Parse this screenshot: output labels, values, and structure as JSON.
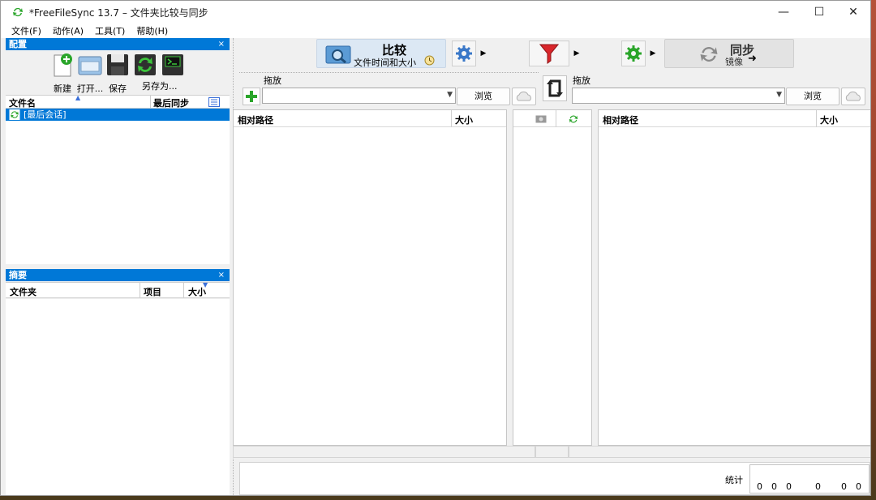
{
  "window": {
    "title": "*FreeFileSync 13.7 – 文件夹比较与同步",
    "minimize": "—",
    "maximize": "☐",
    "close": "✕"
  },
  "menu": [
    "文件(F)",
    "动作(A)",
    "工具(T)",
    "帮助(H)"
  ],
  "config_panel": {
    "title": "配置",
    "close": "×",
    "tools": [
      {
        "label": "新建",
        "icon": "new-config-icon"
      },
      {
        "label": "打开...",
        "icon": "open-config-icon"
      },
      {
        "label": "保存",
        "icon": "save-icon"
      },
      {
        "label": "另存为...",
        "icon": "save-as-icon"
      }
    ],
    "columns": {
      "name": "文件名",
      "last_sync": "最后同步"
    },
    "items": [
      {
        "name": "[最后会话]",
        "selected": true
      }
    ]
  },
  "summary_panel": {
    "title": "摘要",
    "close": "×",
    "columns": {
      "folder": "文件夹",
      "items": "项目",
      "size": "大小"
    }
  },
  "toolbar": {
    "compare": {
      "title": "比较",
      "subtitle": "文件时间和大小"
    },
    "sync": {
      "title": "同步",
      "subtitle": "镜像"
    }
  },
  "left_folder": {
    "drag_label": "拖放",
    "value": "",
    "browse": "浏览"
  },
  "right_folder": {
    "drag_label": "拖放",
    "value": "",
    "browse": "浏览"
  },
  "left_grid": {
    "col_path": "相对路径",
    "col_size": "大小"
  },
  "right_grid": {
    "col_path": "相对路径",
    "col_size": "大小"
  },
  "stats": {
    "label": "统计",
    "values": [
      "0",
      "0",
      "0",
      "0",
      "0",
      "0"
    ]
  },
  "colors": {
    "accent": "#0078d7",
    "bg": "#f0f0f0",
    "sync_green": "#2aa52a",
    "filter_red": "#d9262b"
  }
}
